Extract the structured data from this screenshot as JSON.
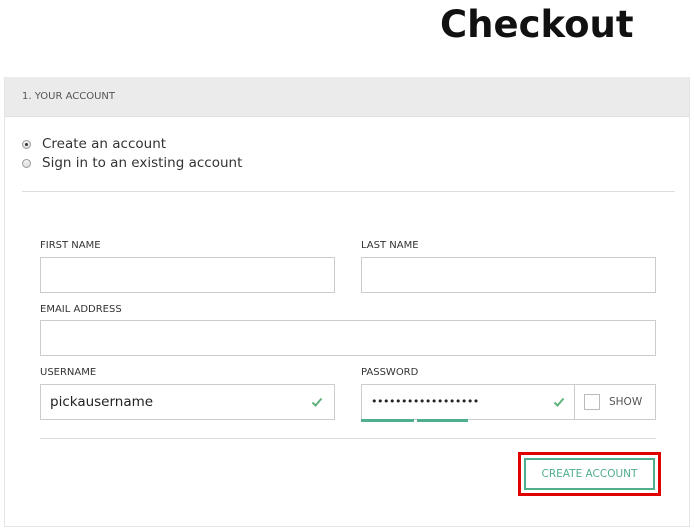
{
  "page": {
    "title": "Checkout"
  },
  "account_section": {
    "header": "1. YOUR ACCOUNT",
    "options": [
      {
        "label": "Create an account",
        "checked": true
      },
      {
        "label": "Sign in to an existing account",
        "checked": false
      }
    ]
  },
  "form": {
    "first_name": {
      "label": "FIRST NAME",
      "value": ""
    },
    "last_name": {
      "label": "LAST NAME",
      "value": ""
    },
    "email": {
      "label": "EMAIL ADDRESS",
      "value": ""
    },
    "username": {
      "label": "USERNAME",
      "value": "pickausername"
    },
    "password": {
      "label": "PASSWORD",
      "value": "••••••••••••••••••",
      "show_label": "SHOW"
    },
    "submit_label": "CREATE ACCOUNT"
  },
  "colors": {
    "accent": "#4fae8c",
    "highlight": "#e00000"
  },
  "icons": {
    "valid": "check-icon"
  }
}
